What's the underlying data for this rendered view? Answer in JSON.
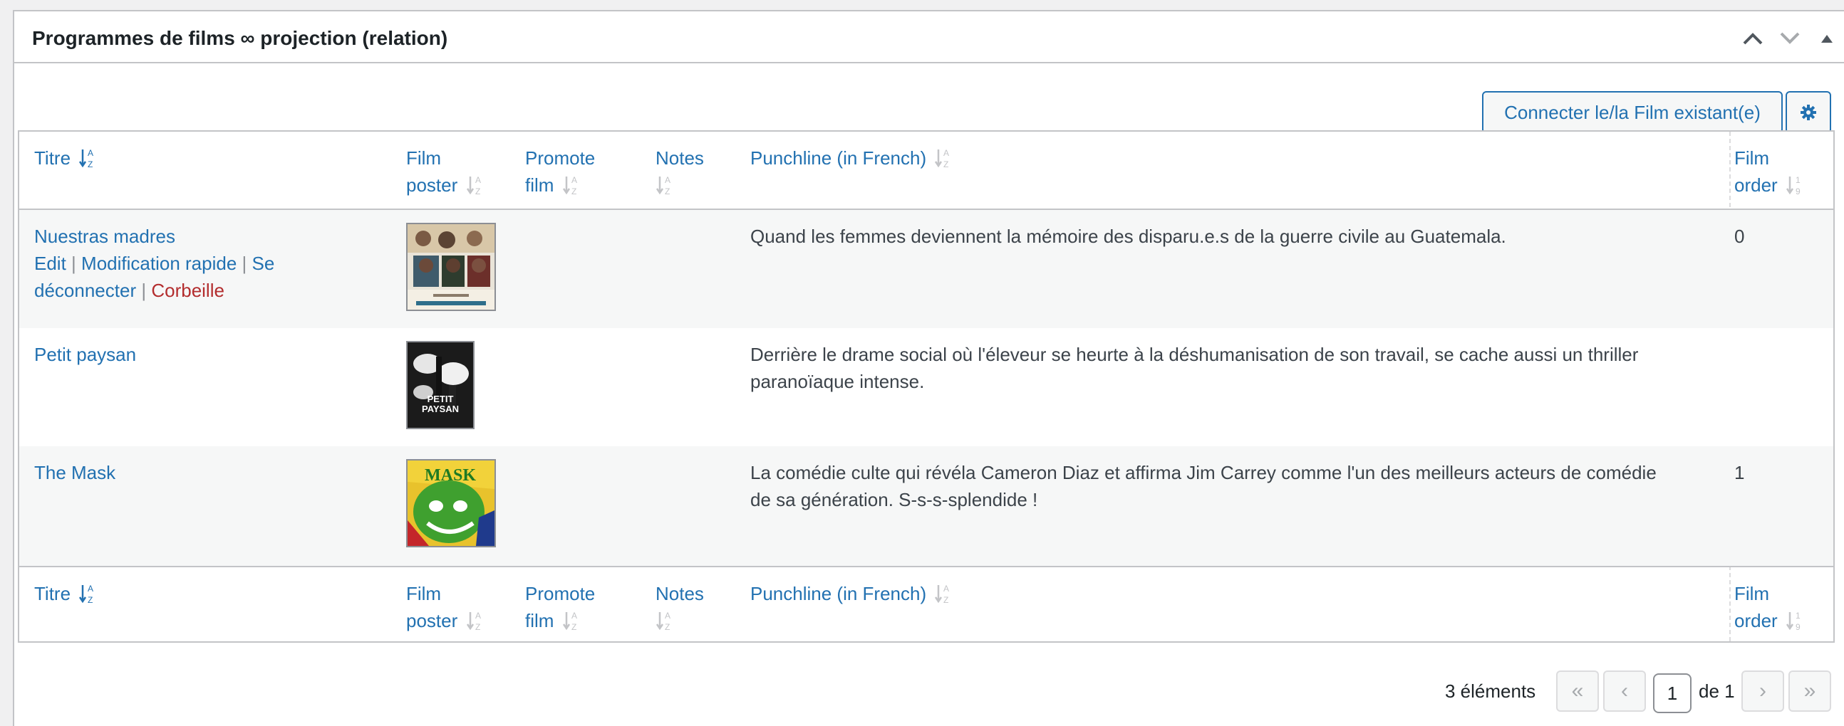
{
  "panel": {
    "title": "Programmes de films ∞ projection (relation)",
    "connect_button": "Connecter le/la Film existant(e)",
    "settings_icon": "gear-icon"
  },
  "columns": {
    "title": "Titre",
    "poster_line1": "Film",
    "poster_line2": "poster",
    "promote_line1": "Promote",
    "promote_line2": "film",
    "notes": "Notes",
    "punchline": "Punchline (in French)",
    "order_line1": "Film",
    "order_line2": "order"
  },
  "rows": [
    {
      "title": "Nuestras madres",
      "actions": {
        "edit": "Edit",
        "quick_edit": "Modification rapide",
        "disconnect_1": "Se",
        "disconnect_2": "déconnecter",
        "trash": "Corbeille",
        "sep": "|"
      },
      "poster_alt": "Nuestras madres poster",
      "punchline": "Quand les femmes deviennent la mémoire des disparu.e.s de la guerre civile au Guatemala.",
      "order": "0"
    },
    {
      "title": "Petit paysan",
      "poster_alt": "Petit paysan poster",
      "poster_text_1": "PETIT",
      "poster_text_2": "PAYSAN",
      "punchline_1": "Derrière le drame social où l'éleveur se heurte à la déshumanisation de son travail, se cache aussi un thriller",
      "punchline_2": "paranoïaque intense.",
      "order": ""
    },
    {
      "title": "The Mask",
      "poster_alt": "The Mask poster",
      "poster_text": "MASK",
      "punchline_1": "La comédie culte qui révéla Cameron Diaz et affirma Jim Carrey comme l'un des meilleurs acteurs de comédie",
      "punchline_2": "de sa génération. S-s-s-splendide !",
      "order": "1"
    }
  ],
  "pagination": {
    "count": "3 éléments",
    "first": "«",
    "prev": "‹",
    "current": "1",
    "of": "de 1",
    "next": "›",
    "last": "»"
  },
  "colors": {
    "link": "#2271b1",
    "trash": "#b32d2e",
    "border": "#c3c4c7"
  }
}
